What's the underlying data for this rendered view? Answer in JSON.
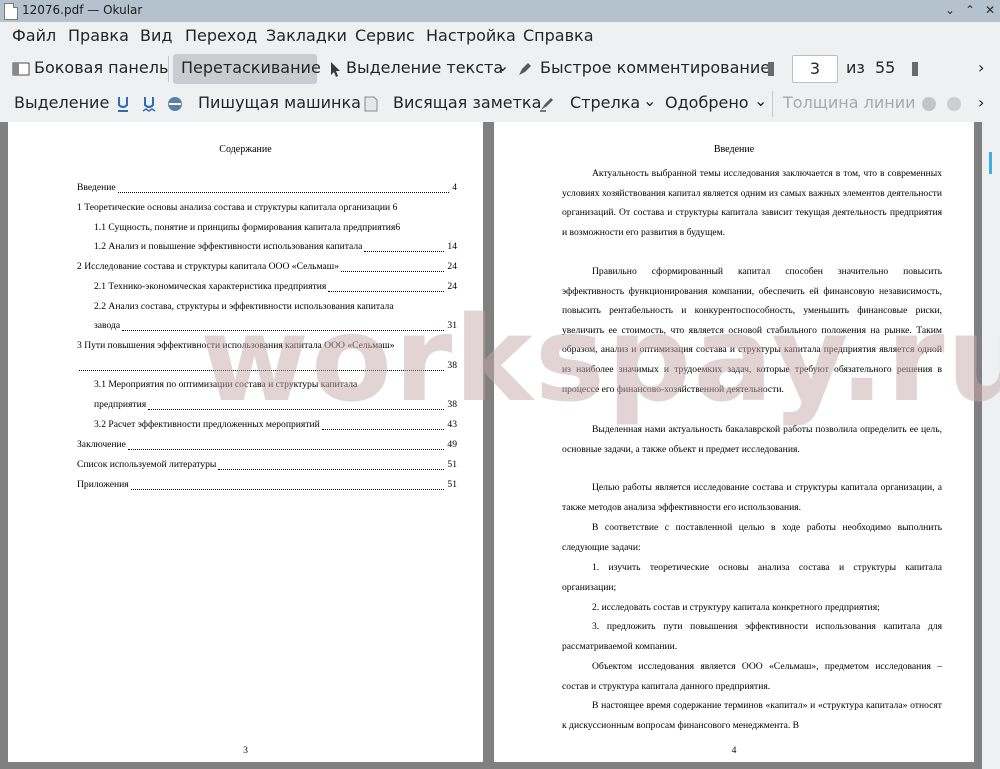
{
  "window": {
    "title": "12076.pdf  — Okular",
    "controls": [
      "⌄",
      "⌃",
      "✕"
    ]
  },
  "menu": [
    "Файл",
    "Правка",
    "Вид",
    "Переход",
    "Закладки",
    "Сервис",
    "Настройка",
    "Справка"
  ],
  "toolbar1": {
    "sidebar": "Боковая панель",
    "drag": "Перетаскивание",
    "text_select": "Выделение текста",
    "quick_comment": "Быстрое комментирование",
    "page_current": "3",
    "page_of": "из",
    "page_total": "55",
    "more": "›"
  },
  "toolbar2": {
    "highlight": "Выделение",
    "typewriter": "Пишущая машинка",
    "note": "Висящая заметка",
    "arrow": "Стрелка",
    "approved": "Одобрено",
    "line_width": "Толщина линии",
    "more": "›"
  },
  "left_page": {
    "heading": "Содержание",
    "number": "3",
    "toc": [
      {
        "text": "Введение",
        "page": "4"
      },
      {
        "text": "1 Теоретические основы анализа состава и структуры капитала организации 6",
        "page": ""
      },
      {
        "text": "1.1 Сущность, понятие и принципы формирования капитала предприятия6",
        "page": ""
      },
      {
        "text": "1.2 Анализ и повышение эффективности использования капитала",
        "page": "14"
      },
      {
        "text": "2 Исследование состава и структуры капитала ООО «Сельмаш»",
        "page": "24"
      },
      {
        "text": "2.1 Технико-экономическая характеристика предприятия",
        "page": "24"
      },
      {
        "text": "2.2 Анализ состава, структуры и эффективности использования капитала",
        "page": ""
      },
      {
        "text": "завода",
        "page": "31"
      },
      {
        "text": "3 Пути повышения эффективности использования капитала ООО «Сельмаш»",
        "page": ""
      },
      {
        "text": "",
        "page": "38"
      },
      {
        "text": "3.1 Мероприятия по оптимизации состава и структуры капитала",
        "page": ""
      },
      {
        "text": "предприятия",
        "page": "38"
      },
      {
        "text": "3.2 Расчет эффективности предложенных мероприятий",
        "page": "43"
      },
      {
        "text": "Заключение",
        "page": "49"
      },
      {
        "text": "Список используемой литературы",
        "page": "51"
      },
      {
        "text": "Приложения",
        "page": "51"
      }
    ]
  },
  "right_page": {
    "heading": "Введение",
    "number": "4",
    "paragraphs": [
      "Актуальность выбранной темы исследования заключается в том, что в современных условиях хозяйствования капитал является одним из самых важных элементов деятельности организаций. От состава и структуры капитала зависит текущая деятельность предприятия и возможности его развития в будущем.",
      "Правильно сформированный капитал способен значительно повысить эффективность функционирования компании, обеспечить ей финансовую независимость, повысить рентабельность и конкурентоспособность, уменьшить финансовые риски, увеличить ее стоимость, что является основой стабильного положения на рынке. Таким образом, анализ и оптимизация состава и структуры капитала предприятия является одной из наиболее значимых и трудоемких задач, которые требуют обязательного решения в процессе его финансово-хозяйственной деятельности.",
      "Выделенная нами актуальность бакалаврской работы позволила определить ее цель, основные задачи, а также объект и предмет исследования.",
      "Целью работы является исследование состава и структуры капитала организации, а также методов анализа эффективности его использования.",
      "В соответствие с поставленной целью в ходе работы необходимо выполнить следующие задачи:",
      "1. изучить теоретические основы анализа состава и структуры капитала организации;",
      "2. исследовать состав и структуру капитала конкретного предприятия;",
      "3. предложить пути повышения эффективности использования капитала для рассматриваемой компании.",
      "Объектом исследования является ООО «Сельмаш», предметом исследования – состав и структура капитала данного предприятия.",
      "В настоящее время содержание терминов «капитал» и «структура капитала» относят к дискуссионным вопросам финансового менеджмента. В"
    ]
  },
  "watermark": "workspay.ru"
}
